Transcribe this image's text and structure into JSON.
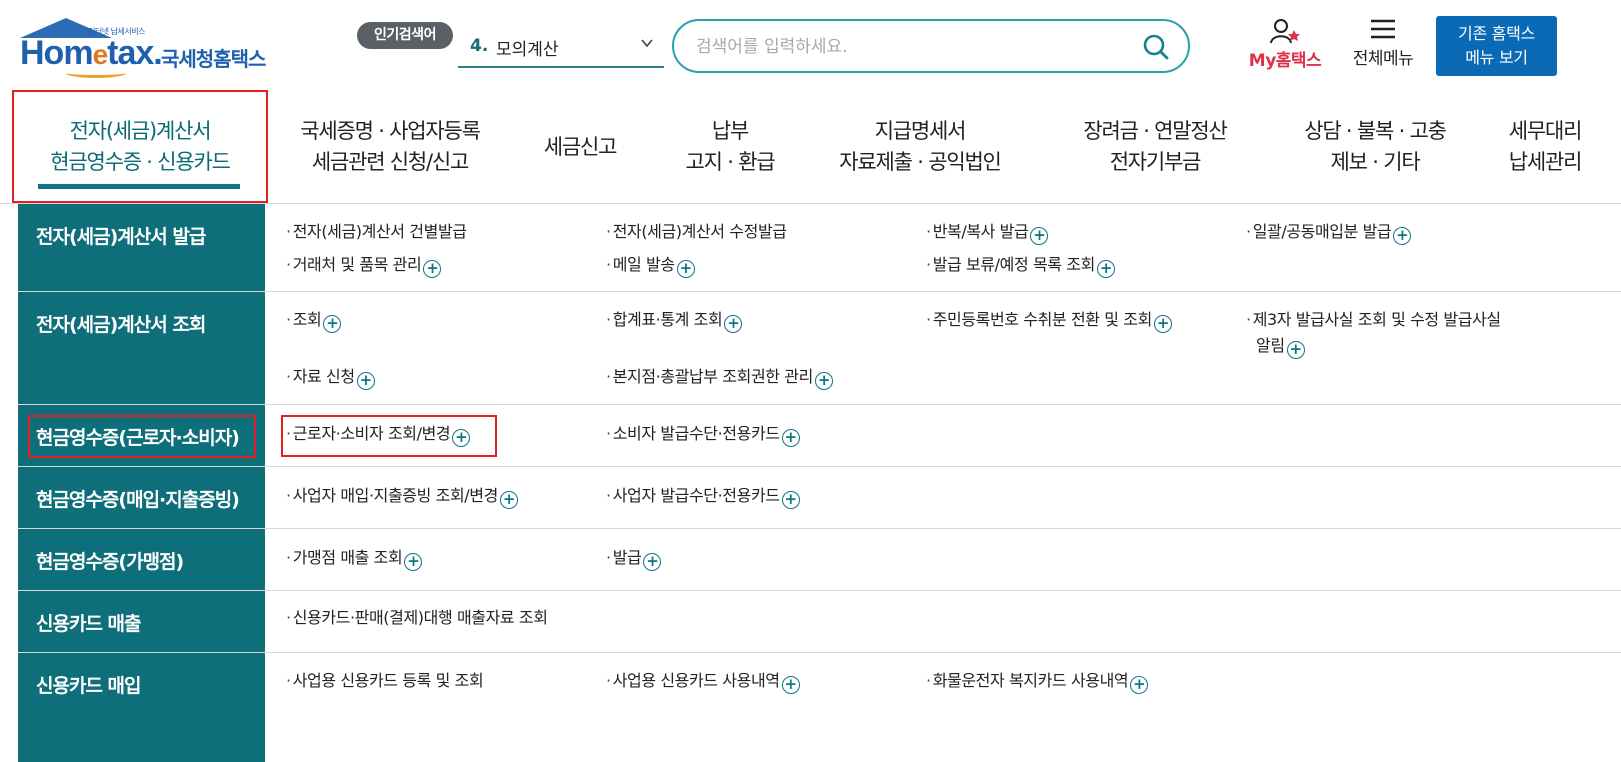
{
  "header": {
    "logo_tiny": "인터넷 납세서비스",
    "logo_home": "Hom",
    "logo_e": "e",
    "logo_tax": "tax.",
    "logo_kr": "국세청홈택스",
    "popular_badge": "인기검색어",
    "popular_num": "4.",
    "popular_value": "모의계산",
    "search_placeholder": "검색어를 입력하세요.",
    "my_hometax": "My홈택스",
    "all_menu": "전체메뉴",
    "old_hometax_line1": "기존 홈택스",
    "old_hometax_line2": "메뉴 보기"
  },
  "gnb": {
    "items": [
      "전자(세금)계산서\n현금영수증 · 신용카드",
      "국세증명 · 사업자등록\n세금관련 신청/신고",
      "세금신고",
      "납부\n고지 · 환급",
      "지급명세서\n자료제출 · 공익법인",
      "장려금 · 연말정산\n전자기부금",
      "상담 · 불복 · 고충\n제보 · 기타",
      "세무대리\n납세관리"
    ]
  },
  "submenu": {
    "rows": [
      {
        "category": "전자(세금)계산서 발급",
        "links": [
          "전자(세금)계산서 건별발급",
          "전자(세금)계산서 수정발급",
          "반복/복사 발급",
          "일괄/공동매입분 발급",
          "거래처 및 품목 관리",
          "메일 발송",
          "발급 보류/예정 목록 조회"
        ]
      },
      {
        "category": "전자(세금)계산서 조회",
        "links": [
          "조회",
          "합계표·통계 조회",
          "주민등록번호 수취분 전환 및 조회",
          "제3자 발급사실 조회 및 수정 발급사실",
          "알림",
          "자료 신청",
          "본지점·총괄납부 조회권한 관리"
        ]
      },
      {
        "category": "현금영수증(근로자·소비자)",
        "links": [
          "근로자·소비자 조회/변경",
          "소비자 발급수단·전용카드"
        ]
      },
      {
        "category": "현금영수증(매입·지출증빙)",
        "links": [
          "사업자 매입·지출증빙 조회/변경",
          "사업자 발급수단·전용카드"
        ]
      },
      {
        "category": "현금영수증(가맹점)",
        "links": [
          "가맹점 매출 조회",
          "발급"
        ]
      },
      {
        "category": "신용카드 매출",
        "links": [
          "신용카드·판매(결제)대행 매출자료 조회"
        ]
      },
      {
        "category": "신용카드 매입",
        "links": [
          "사업용 신용카드 등록 및 조회",
          "사업용 신용카드 사용내역",
          "화물운전자 복지카드 사용내역"
        ]
      }
    ]
  },
  "icons": {
    "plus": "+",
    "bullet": "·"
  },
  "colors": {
    "teal": "#0e6e7a",
    "highlight_red": "#e32020",
    "brand_blue": "#0b6ab5",
    "my_red": "#e0304a"
  }
}
